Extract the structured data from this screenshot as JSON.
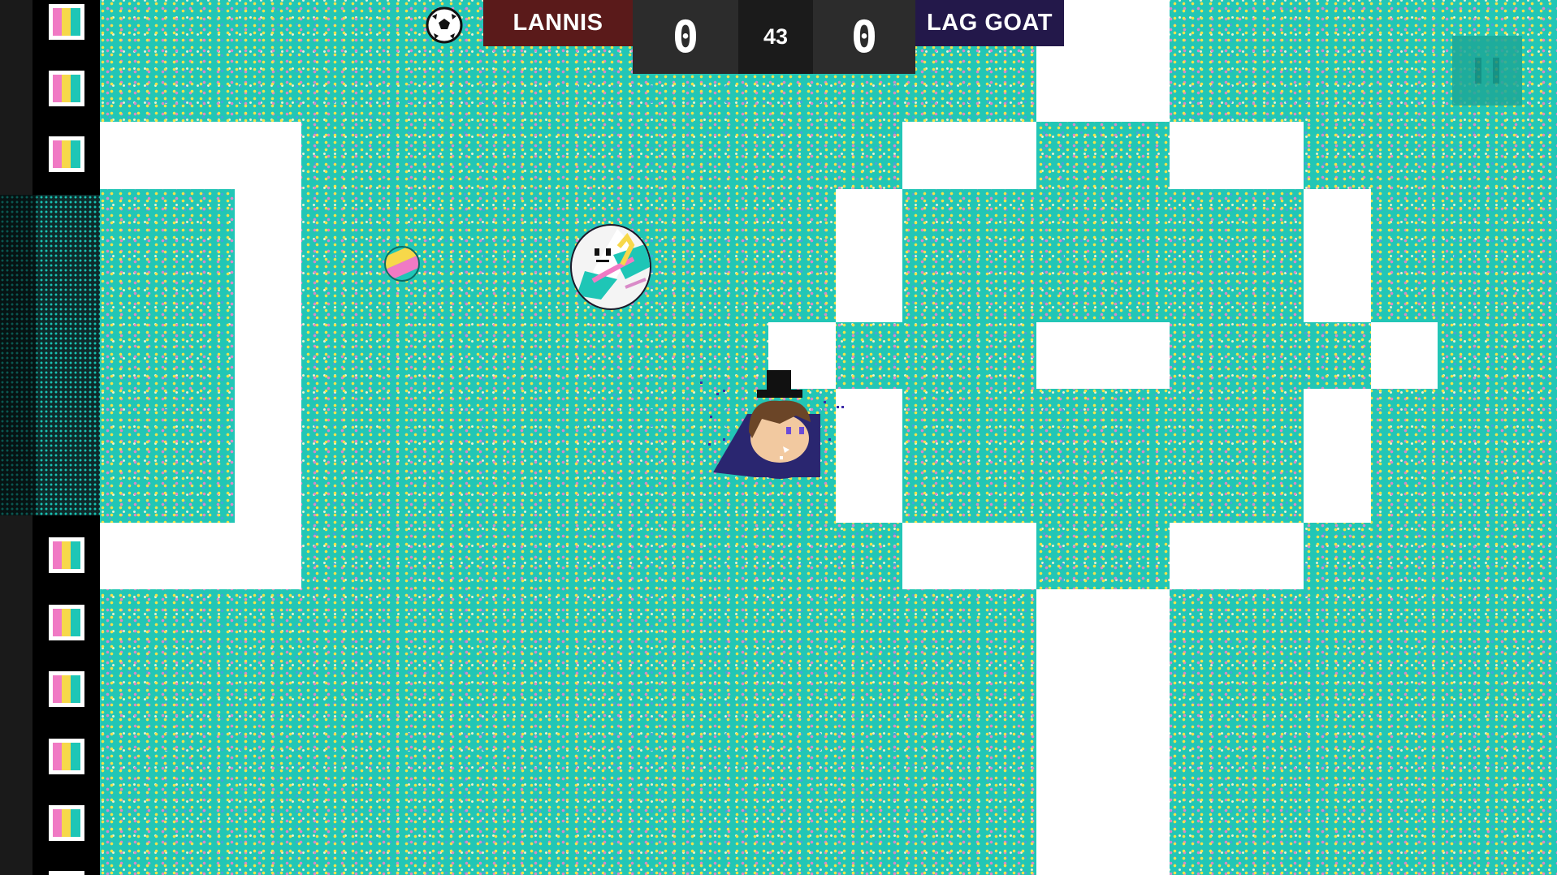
{
  "scoreboard": {
    "home_team": "LANNIS",
    "home_score": "0",
    "timer": "43",
    "away_score": "0",
    "away_team": "LAG GOAT",
    "home_color": "#5a1a1a",
    "away_color": "#23184a"
  },
  "icons": {
    "game_mode": "soccer-ball-icon",
    "pause": "pause-icon",
    "side_flag": "tricolor-flag-icon"
  },
  "colors": {
    "pitch": "#22c6b6",
    "lines": "#ffffff",
    "flag": [
      "#f07ac4",
      "#f7d84a",
      "#1ec6b6"
    ]
  },
  "players": {
    "home_player": "avatar with top hat and navy cape",
    "ball": "white marbled ball with face"
  }
}
